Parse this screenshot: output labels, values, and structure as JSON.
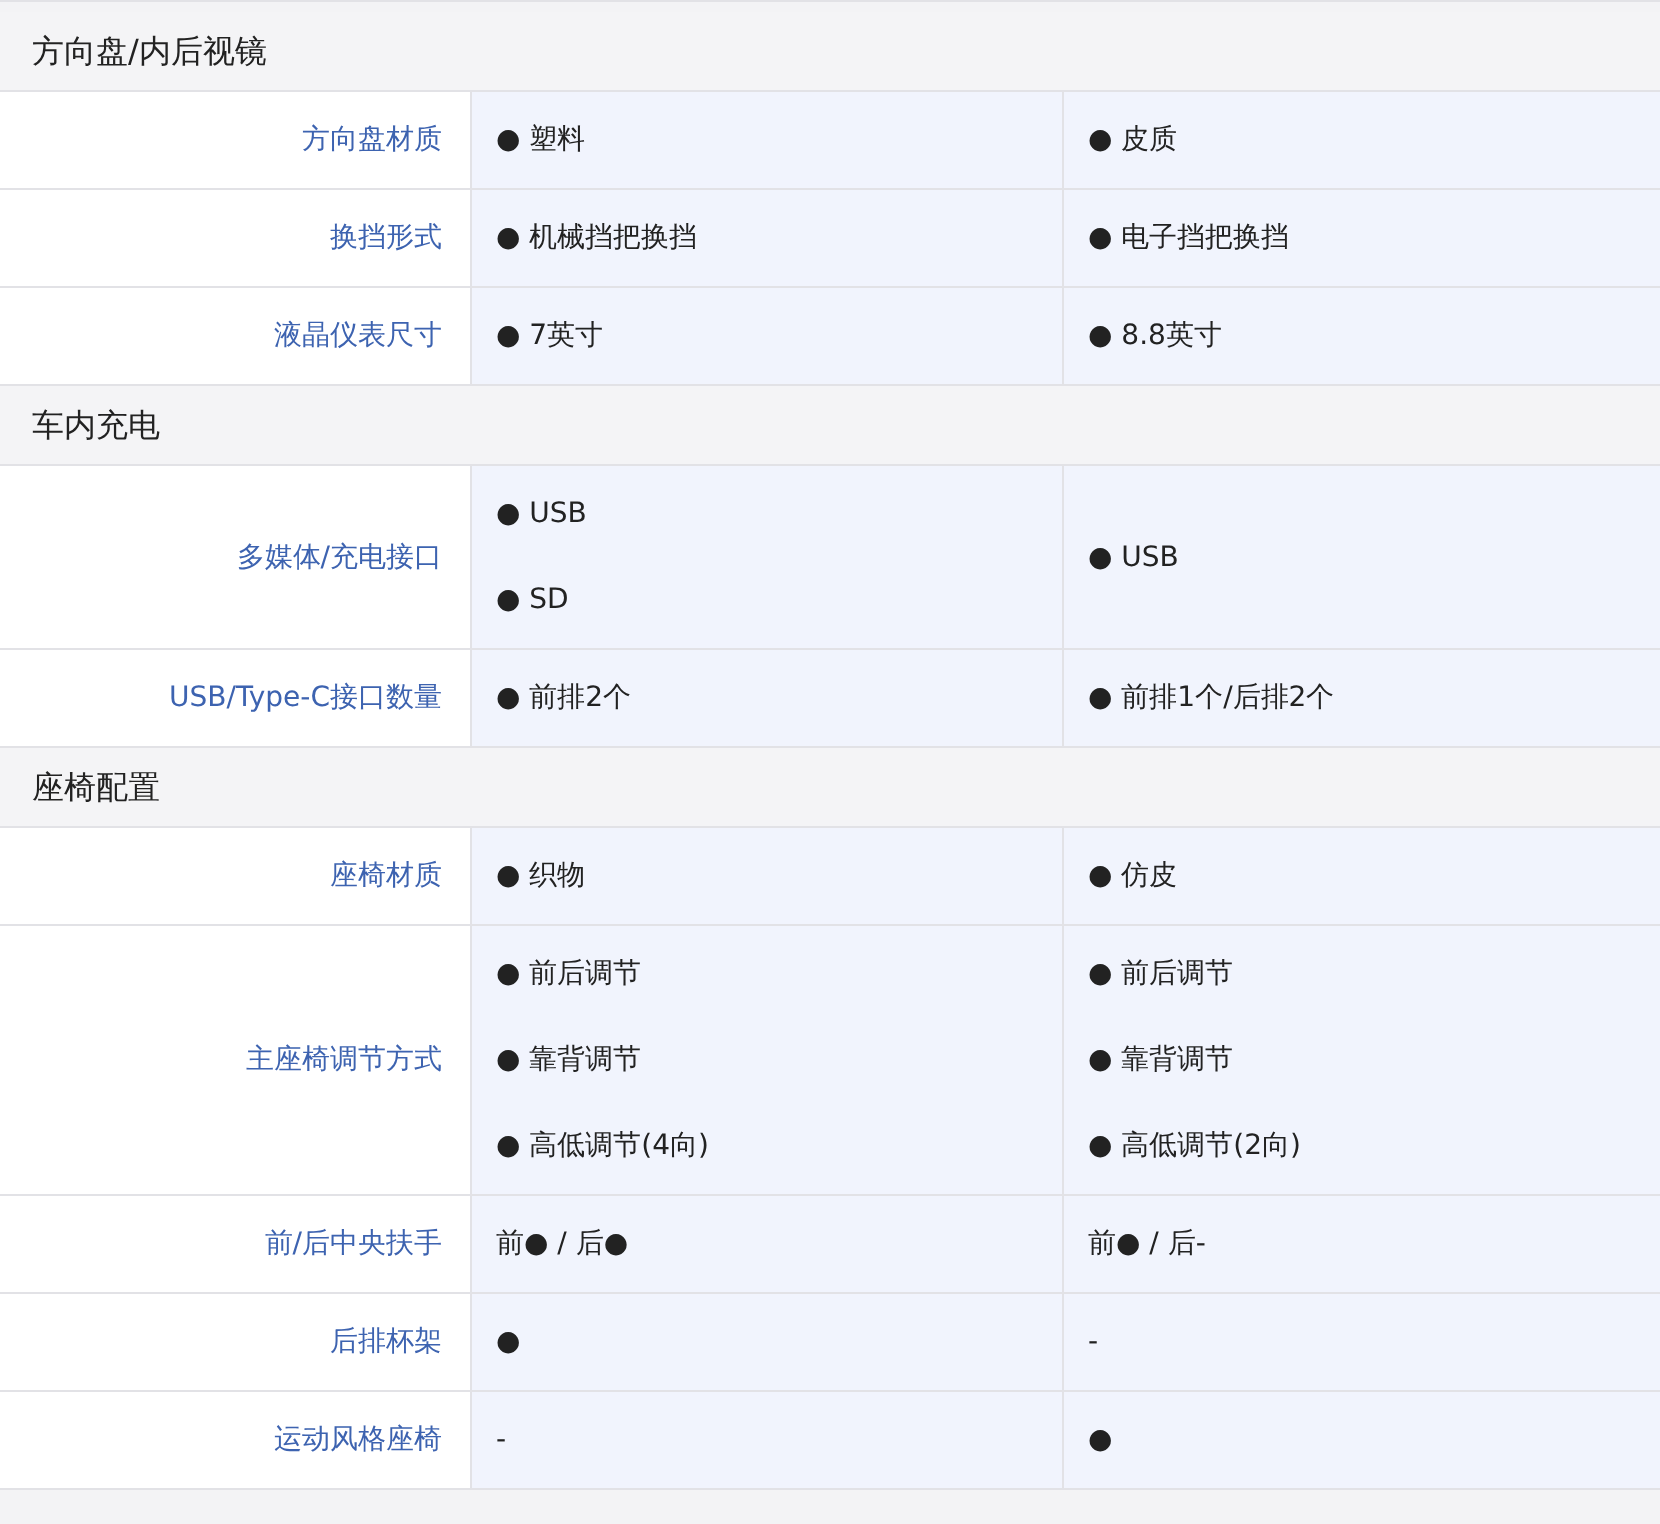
{
  "sections": [
    {
      "title": "方向盘/内后视镜",
      "rows": [
        {
          "label": "方向盘材质",
          "cells": [
            [
              "● 塑料"
            ],
            [
              "● 皮质"
            ]
          ]
        },
        {
          "label": "换挡形式",
          "cells": [
            [
              "● 机械挡把换挡"
            ],
            [
              "● 电子挡把换挡"
            ]
          ]
        },
        {
          "label": "液晶仪表尺寸",
          "cells": [
            [
              "● 7英寸"
            ],
            [
              "● 8.8英寸"
            ]
          ]
        }
      ]
    },
    {
      "title": "车内充电",
      "rows": [
        {
          "label": "多媒体/充电接口",
          "cells": [
            [
              "● USB",
              "● SD"
            ],
            [
              "● USB"
            ]
          ]
        },
        {
          "label": "USB/Type-C接口数量",
          "cells": [
            [
              "● 前排2个"
            ],
            [
              "● 前排1个/后排2个"
            ]
          ]
        }
      ]
    },
    {
      "title": "座椅配置",
      "rows": [
        {
          "label": "座椅材质",
          "cells": [
            [
              "● 织物"
            ],
            [
              "● 仿皮"
            ]
          ]
        },
        {
          "label": "主座椅调节方式",
          "cells": [
            [
              "● 前后调节",
              "● 靠背调节",
              "● 高低调节(4向)"
            ],
            [
              "● 前后调节",
              "● 靠背调节",
              "● 高低调节(2向)"
            ]
          ]
        },
        {
          "label": "前/后中央扶手",
          "cells": [
            [
              "前● / 后●"
            ],
            [
              "前● / 后-"
            ]
          ]
        },
        {
          "label": "后排杯架",
          "cells": [
            [
              "●"
            ],
            [
              "-"
            ]
          ]
        },
        {
          "label": "运动风格座椅",
          "cells": [
            [
              "-"
            ],
            [
              "●"
            ]
          ]
        }
      ]
    }
  ]
}
